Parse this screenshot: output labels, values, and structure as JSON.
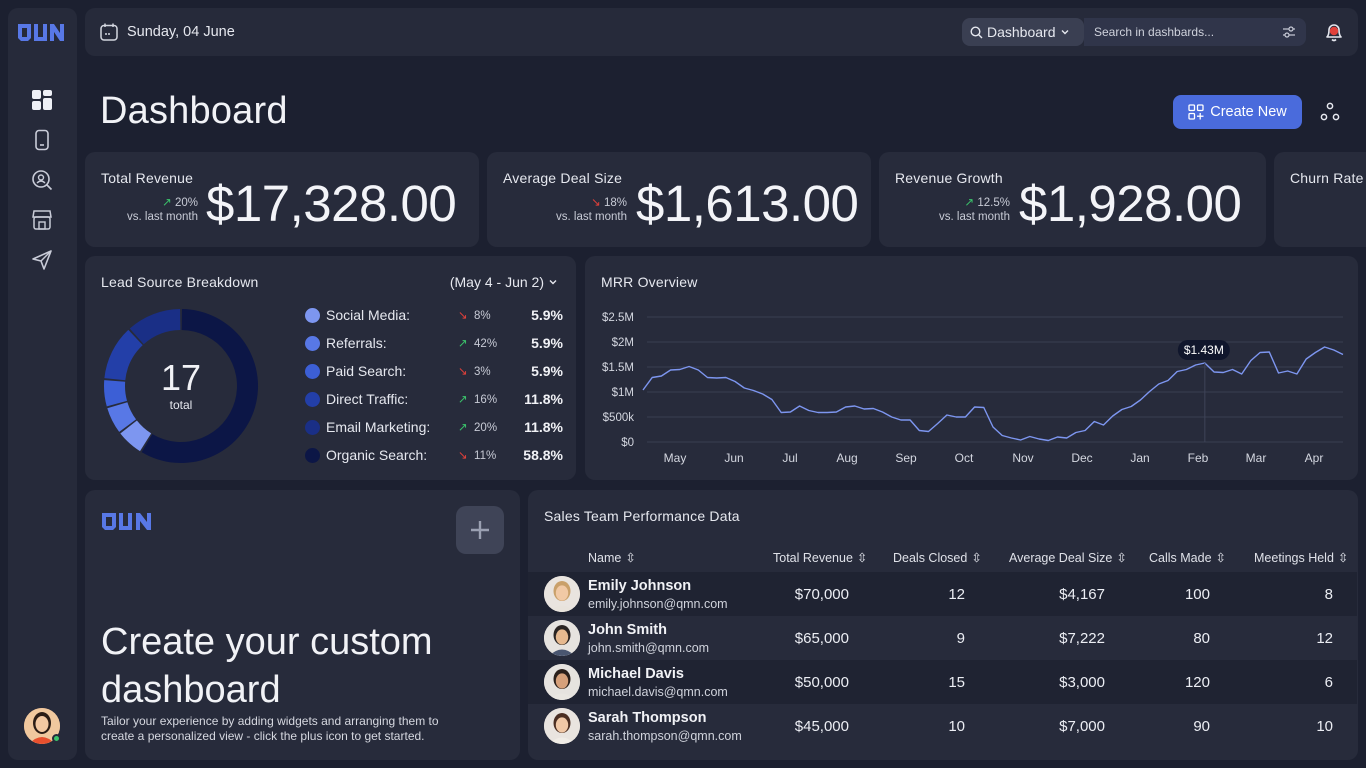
{
  "topbar": {
    "date": "Sunday, 04 June",
    "dashboard_select": "Dashboard",
    "search_placeholder": "Search in dashbards..."
  },
  "header": {
    "title": "Dashboard",
    "create_label": "Create New"
  },
  "kpis": [
    {
      "label": "Total Revenue",
      "change": "20%",
      "direction": "up",
      "compare": "vs. last month",
      "value": "$17,328.00"
    },
    {
      "label": "Average Deal Size",
      "change": "18%",
      "direction": "down",
      "compare": "vs. last month",
      "value": "$1,613.00"
    },
    {
      "label": "Revenue Growth",
      "change": "12.5%",
      "direction": "up",
      "compare": "vs. last month",
      "value": "$1,928.00"
    },
    {
      "label": "Churn Rate"
    }
  ],
  "lead_source": {
    "title": "Lead Source Breakdown",
    "range": "(May 4 - Jun 2)",
    "total": "17",
    "total_label": "total",
    "items": [
      {
        "name": "Social Media:",
        "change": "8%",
        "direction": "down",
        "share": "5.9%",
        "color": "#7d96f0"
      },
      {
        "name": "Referrals:",
        "change": "42%",
        "direction": "up",
        "share": "5.9%",
        "color": "#5878e6"
      },
      {
        "name": "Paid Search:",
        "change": "3%",
        "direction": "down",
        "share": "5.9%",
        "color": "#3c5fd6"
      },
      {
        "name": "Direct Traffic:",
        "change": "16%",
        "direction": "up",
        "share": "11.8%",
        "color": "#233fa8"
      },
      {
        "name": "Email Marketing:",
        "change": "20%",
        "direction": "up",
        "share": "11.8%",
        "color": "#1a2f86"
      },
      {
        "name": "Organic Search:",
        "change": "11%",
        "direction": "down",
        "share": "58.8%",
        "color": "#0c1646"
      }
    ]
  },
  "chart_data": {
    "type": "line",
    "title": "MRR Overview",
    "x_categories": [
      "May",
      "Jun",
      "Jul",
      "Aug",
      "Sep",
      "Oct",
      "Nov",
      "Dec",
      "Jan",
      "Feb",
      "Mar",
      "Apr"
    ],
    "y_ticks": [
      "$0",
      "$500k",
      "$1M",
      "$1.5M",
      "$2M",
      "$2.5M"
    ],
    "ylim": [
      0,
      2500000
    ],
    "grid": true,
    "highlight_label": "$1.43M",
    "series": [
      {
        "color": "#7d96f0",
        "values": [
          1.04,
          1.29,
          1.32,
          1.44,
          1.45,
          1.51,
          1.44,
          1.29,
          1.28,
          1.29,
          1.21,
          1.08,
          1.03,
          0.96,
          0.85,
          0.59,
          0.6,
          0.72,
          0.63,
          0.59,
          0.59,
          0.6,
          0.7,
          0.72,
          0.66,
          0.67,
          0.6,
          0.5,
          0.44,
          0.44,
          0.23,
          0.21,
          0.37,
          0.54,
          0.5,
          0.5,
          0.7,
          0.69,
          0.3,
          0.13,
          0.08,
          0.04,
          0.11,
          0.06,
          0.03,
          0.1,
          0.08,
          0.19,
          0.23,
          0.41,
          0.34,
          0.52,
          0.65,
          0.71,
          0.84,
          1.01,
          1.16,
          1.23,
          1.41,
          1.45,
          1.54,
          1.58,
          1.4,
          1.39,
          1.45,
          1.36,
          1.63,
          1.79,
          1.8,
          1.38,
          1.42,
          1.36,
          1.66,
          1.79,
          1.9,
          1.84,
          1.75
        ],
        "unit": "$M"
      }
    ]
  },
  "promo": {
    "title": "Create your custom dashboard",
    "text": "Tailor your experience by adding widgets and arranging them to create a personalized view - click the plus icon to get started."
  },
  "table": {
    "title": "Sales Team Performance Data",
    "columns": [
      "Name",
      "Total Revenue",
      "Deals Closed",
      "Average Deal Size",
      "Calls Made",
      "Meetings Held"
    ],
    "rows": [
      {
        "name": "Emily Johnson",
        "email": "emily.johnson@qmn.com",
        "revenue": "$70,000",
        "deals": "12",
        "avg": "$4,167",
        "calls": "100",
        "meetings": "8"
      },
      {
        "name": "John Smith",
        "email": "john.smith@qmn.com",
        "revenue": "$65,000",
        "deals": "9",
        "avg": "$7,222",
        "calls": "80",
        "meetings": "12"
      },
      {
        "name": "Michael Davis",
        "email": "michael.davis@qmn.com",
        "revenue": "$50,000",
        "deals": "15",
        "avg": "$3,000",
        "calls": "120",
        "meetings": "6"
      },
      {
        "name": "Sarah Thompson",
        "email": "sarah.thompson@qmn.com",
        "revenue": "$45,000",
        "deals": "10",
        "avg": "$7,000",
        "calls": "90",
        "meetings": "10"
      }
    ]
  },
  "colors": {
    "accent": "#4a6bdc",
    "background": "#1c2030",
    "panel": "#272b3b",
    "up": "#3bc46b",
    "down": "#e0403a"
  }
}
